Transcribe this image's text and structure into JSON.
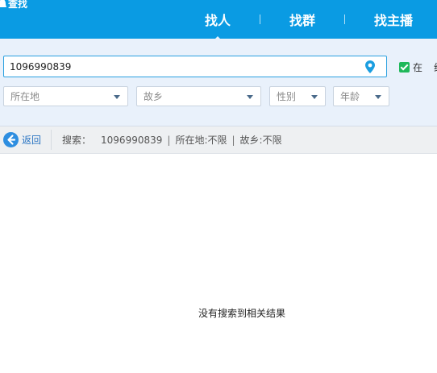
{
  "app": {
    "title": "查找"
  },
  "tabs": [
    {
      "label": "找人",
      "active": true
    },
    {
      "label": "找群",
      "active": false
    },
    {
      "label": "找主播",
      "active": false
    }
  ],
  "search": {
    "value": "1096990839",
    "placeholder": ""
  },
  "online_filter": {
    "checked": true,
    "label_a": "在",
    "label_b": "线"
  },
  "filters": [
    {
      "label": "所在地"
    },
    {
      "label": "故乡"
    },
    {
      "label": "性别"
    },
    {
      "label": "年龄"
    }
  ],
  "result_bar": {
    "back_label": "返回",
    "search_key": "搜索：",
    "search_value": "1096990839",
    "location": "所在地:不限",
    "hometown": "故乡:不限"
  },
  "empty_message": "没有搜索到相关结果",
  "colors": {
    "header": "#0a9be3",
    "panel": "#e9f1fb",
    "accent": "#2aa0e0",
    "check": "#1fb85a",
    "link": "#2b75c3"
  }
}
